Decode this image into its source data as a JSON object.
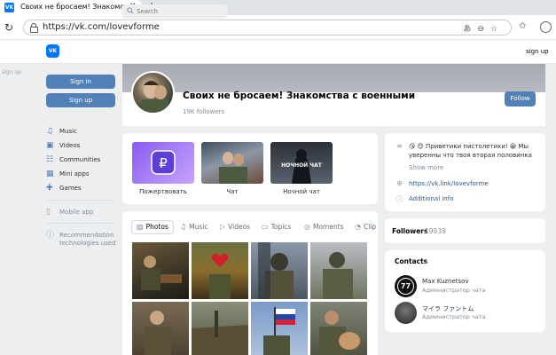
{
  "browser": {
    "tab_title": "Своих не бросаем! Знакомства с",
    "tab_close": "✕",
    "new_tab": "+",
    "url": "https://vk.com/lovevforme"
  },
  "vk": {
    "logo": "VK",
    "search_placeholder": "Search",
    "sign_up_top": "sign up",
    "side_sign_up": "sign up"
  },
  "left_nav": {
    "sign_in": "Sign in",
    "sign_up": "Sign up",
    "items": [
      {
        "label": "Music",
        "icon": "music-icon"
      },
      {
        "label": "Videos",
        "icon": "video-icon"
      },
      {
        "label": "Communities",
        "icon": "communities-icon"
      },
      {
        "label": "Mini apps",
        "icon": "apps-icon"
      },
      {
        "label": "Games",
        "icon": "games-icon"
      }
    ],
    "mobile_app": "Mobile app",
    "recommendation": "Recommendation technologies used"
  },
  "group": {
    "title": "Своих не бросаем! Знакомства с военными",
    "followers_short": "19K followers",
    "follow": "Follow"
  },
  "links": [
    {
      "label": "Пожертвовать"
    },
    {
      "label": "Чат"
    },
    {
      "label": "Ночной чат",
      "overlay": "НОЧНОЙ ЧАТ"
    }
  ],
  "media_tabs": [
    {
      "label": "Photos",
      "active": true
    },
    {
      "label": "Music",
      "active": false
    },
    {
      "label": "Videos",
      "active": false
    },
    {
      "label": "Topics",
      "active": false
    },
    {
      "label": "Moments",
      "active": false
    },
    {
      "label": "Clip",
      "active": false
    }
  ],
  "info": {
    "description": "😘 😊 Приветики пистолетики! 😀 Мы уверенны что твоя вторая половинка именно ждёт тебя здесь! ❤️💁 Скорее з...",
    "show_more": "Show more",
    "link": "https://vk.link/lovevforme",
    "additional": "Additional info"
  },
  "followers": {
    "label": "Followers",
    "count": "19939"
  },
  "contacts": {
    "label": "Contacts",
    "count": "2",
    "items": [
      {
        "name": "Max Kuznetsov",
        "role": "Администратор чата",
        "badge": "77"
      },
      {
        "name": "マイラ ファントム",
        "role": "Администратор чата"
      }
    ]
  },
  "colors": {
    "accent": "#5181b8",
    "vk_blue": "#0077ff",
    "background": "#edeef0"
  }
}
